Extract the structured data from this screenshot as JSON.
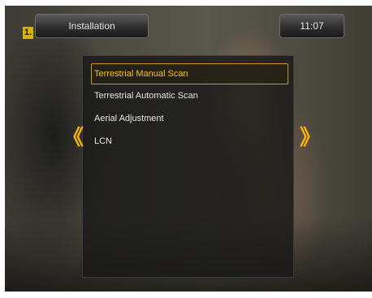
{
  "header": {
    "title": "Installation",
    "clock": "11:07",
    "channel_badge": "1."
  },
  "menu": {
    "items": [
      {
        "label": "Terrestrial Manual Scan",
        "selected": true
      },
      {
        "label": "Terrestrial Automatic Scan",
        "selected": false
      },
      {
        "label": "Aerial Adjustment",
        "selected": false
      },
      {
        "label": "LCN",
        "selected": false
      }
    ]
  },
  "nav": {
    "left_arrow_icon": "double-chevron-left-icon",
    "left_arrow_glyph": "《",
    "right_arrow_icon": "double-chevron-right-icon",
    "right_arrow_glyph": "》"
  },
  "colors": {
    "accent": "#f2c200",
    "arrow": "#ffb400",
    "selection_border": "#c59a1e"
  }
}
